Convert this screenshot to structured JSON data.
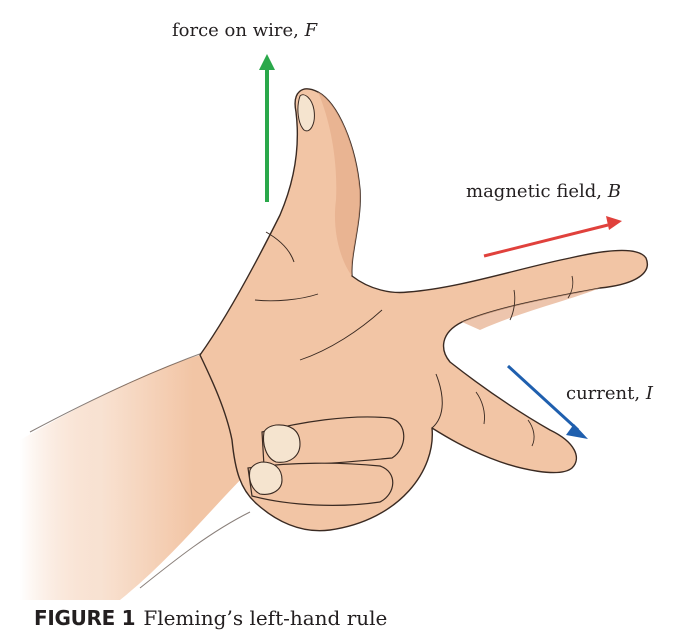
{
  "labels": {
    "force": {
      "text": "force on wire, ",
      "symbol": "F"
    },
    "field": {
      "text": "magnetic field, ",
      "symbol": "B"
    },
    "current": {
      "text": "current, ",
      "symbol": "I"
    }
  },
  "caption": {
    "label": "FIGURE 1",
    "text": "Fleming’s left-hand rule"
  },
  "colors": {
    "force_arrow": "#2aa84a",
    "field_arrow": "#e0413c",
    "current_arrow": "#1f5fae",
    "skin": "#f2c5a5",
    "skin_shadow": "#e6ac8a",
    "outline": "#3a2a22",
    "nail": "#f5e4cf"
  }
}
